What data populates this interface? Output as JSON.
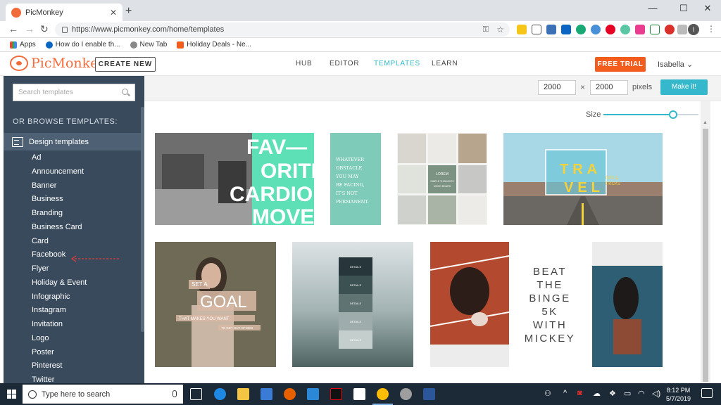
{
  "browser": {
    "tab_title": "PicMonkey",
    "url": "https://www.picmonkey.com/home/templates",
    "profile_initial": "I",
    "bookmarks": [
      "Apps",
      "How do I enable th...",
      "New Tab",
      "Holiday Deals - Ne..."
    ]
  },
  "header": {
    "logo": "PicMonkey",
    "create_new": "CREATE NEW",
    "nav": [
      "HUB",
      "EDITOR",
      "TEMPLATES",
      "LEARN"
    ],
    "active_nav": "TEMPLATES",
    "free_trial": "FREE TRIAL",
    "user_name": "Isabella"
  },
  "sidebar": {
    "search_placeholder": "Search templates",
    "browse_label": "OR BROWSE TEMPLATES:",
    "section": "Design templates",
    "categories": [
      "Ad",
      "Announcement",
      "Banner",
      "Business",
      "Branding",
      "Business Card",
      "Card",
      "Facebook",
      "Flyer",
      "Holiday & Event",
      "Infographic",
      "Instagram",
      "Invitation",
      "Logo",
      "Poster",
      "Pinterest",
      "Twitter"
    ]
  },
  "toolbar": {
    "width": "2000",
    "height": "2000",
    "times": "×",
    "pixels_label": "pixels",
    "make_it": "Make it!"
  },
  "content": {
    "size_label": "Size",
    "size_value": 0.73,
    "templates": [
      {
        "lines": [
          "FAV—",
          "ORITE",
          "CARDIO",
          "MOVES"
        ]
      },
      {
        "lines": [
          "WHATEVER",
          "OBSTACLE",
          "YOU MAY",
          "BE FACING,",
          "IT'S NOT",
          "PERMANENT."
        ]
      },
      {
        "lines": [
          "LOREM",
          "SIMPLE THOUGHTS",
          "MOOD BOARD"
        ]
      },
      {
        "lines": [
          "TRA",
          "VEL",
          "TIPS &",
          "TRICKS"
        ]
      },
      {
        "lines": [
          "SET A",
          "GOAL",
          "THAT MAKES YOU WANT",
          "TO GET OUT OF BED"
        ]
      },
      {
        "lines": [
          "DETAILS",
          "DETAILS",
          "DETAILS",
          "DETAILS",
          "DETAILS"
        ]
      },
      {
        "lines": [
          "BEAT",
          "THE",
          "BINGE",
          "5K",
          "WITH",
          "MICKEY"
        ]
      }
    ]
  },
  "taskbar": {
    "search_text": "Type here to search",
    "time": "8:12 PM",
    "date": "5/7/2019"
  }
}
